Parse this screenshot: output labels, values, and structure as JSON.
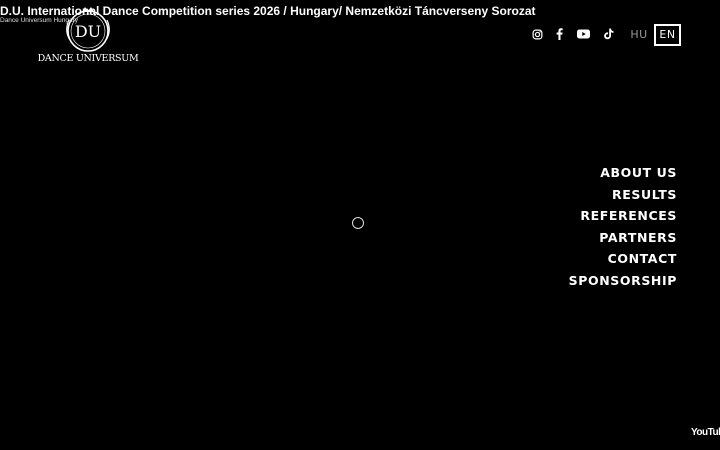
{
  "video": {
    "title": "D.U. International Dance Competition series 2026 / Hungary/ Nemzetközi Táncverseny Sorozat",
    "channel": "Dance Universum Hungary",
    "watermark": "YouTube"
  },
  "brand": {
    "monogram": "DU",
    "wordmark": "DANCE UNIVERSUM"
  },
  "social": {
    "items": [
      {
        "icon": "instagram-icon"
      },
      {
        "icon": "facebook-icon"
      },
      {
        "icon": "youtube-icon"
      },
      {
        "icon": "tiktok-icon"
      }
    ]
  },
  "languages": {
    "hu": "HU",
    "en": "EN",
    "active": "EN"
  },
  "nav": {
    "items": [
      {
        "label": "ABOUT US"
      },
      {
        "label": "RESULTS"
      },
      {
        "label": "REFERENCES"
      },
      {
        "label": "PARTNERS"
      },
      {
        "label": "CONTACT"
      },
      {
        "label": "SPONSORSHIP"
      }
    ]
  },
  "colors": {
    "background": "#000000",
    "text": "#ffffff",
    "inactive_language": "#9a9a9a"
  }
}
